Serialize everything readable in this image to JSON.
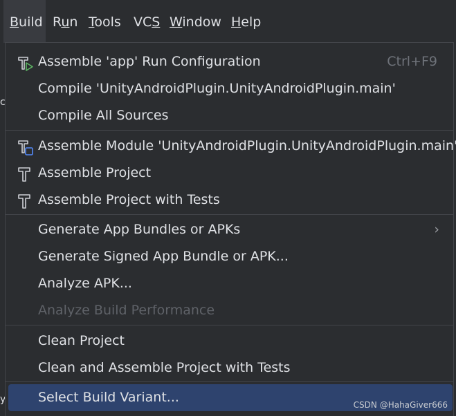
{
  "menubar": {
    "items": [
      {
        "label": "Build",
        "mnemonic": "B",
        "rest": "uild"
      },
      {
        "label": "Run",
        "pre": "R",
        "mnemonic": "u",
        "rest": "n"
      },
      {
        "label": "Tools",
        "mnemonic": "T",
        "rest": "ools"
      },
      {
        "label": "VCS",
        "pre": "VC",
        "mnemonic": "S",
        "rest": ""
      },
      {
        "label": "Window",
        "mnemonic": "W",
        "rest": "indow"
      },
      {
        "label": "Help",
        "mnemonic": "H",
        "rest": "elp"
      }
    ]
  },
  "left_edge": {
    "top_glyph": "c",
    "bottom_glyph": "y"
  },
  "build_menu": {
    "items": [
      {
        "label": "Assemble 'app' Run Configuration",
        "shortcut": "Ctrl+F9",
        "icon": "hammer-run-icon"
      },
      {
        "label": "Compile 'UnityAndroidPlugin.UnityAndroidPlugin.main'"
      },
      {
        "label": "Compile All Sources"
      },
      {
        "label": "Assemble Module 'UnityAndroidPlugin.UnityAndroidPlugin.main'",
        "icon": "hammer-module-icon"
      },
      {
        "label": "Assemble Project",
        "icon": "hammer-icon"
      },
      {
        "label": "Assemble Project with Tests",
        "icon": "hammer-icon"
      },
      {
        "label": "Generate App Bundles or APKs",
        "submenu": "›"
      },
      {
        "label": "Generate Signed App Bundle or APK..."
      },
      {
        "label": "Analyze APK..."
      },
      {
        "label": "Analyze Build Performance",
        "disabled": true
      },
      {
        "label": "Clean Project"
      },
      {
        "label": "Clean and Assemble Project with Tests"
      },
      {
        "label": "Select Build Variant...",
        "selected": true
      }
    ]
  },
  "watermark": "CSDN @HahaGiver666",
  "colors": {
    "background": "#2b2d30",
    "selection": "#2e436e",
    "separator": "#43454a",
    "text": "#dfe1e5",
    "disabled_text": "#5f6268",
    "icon_accent_green": "#5fb865",
    "icon_accent_blue": "#548af7"
  }
}
